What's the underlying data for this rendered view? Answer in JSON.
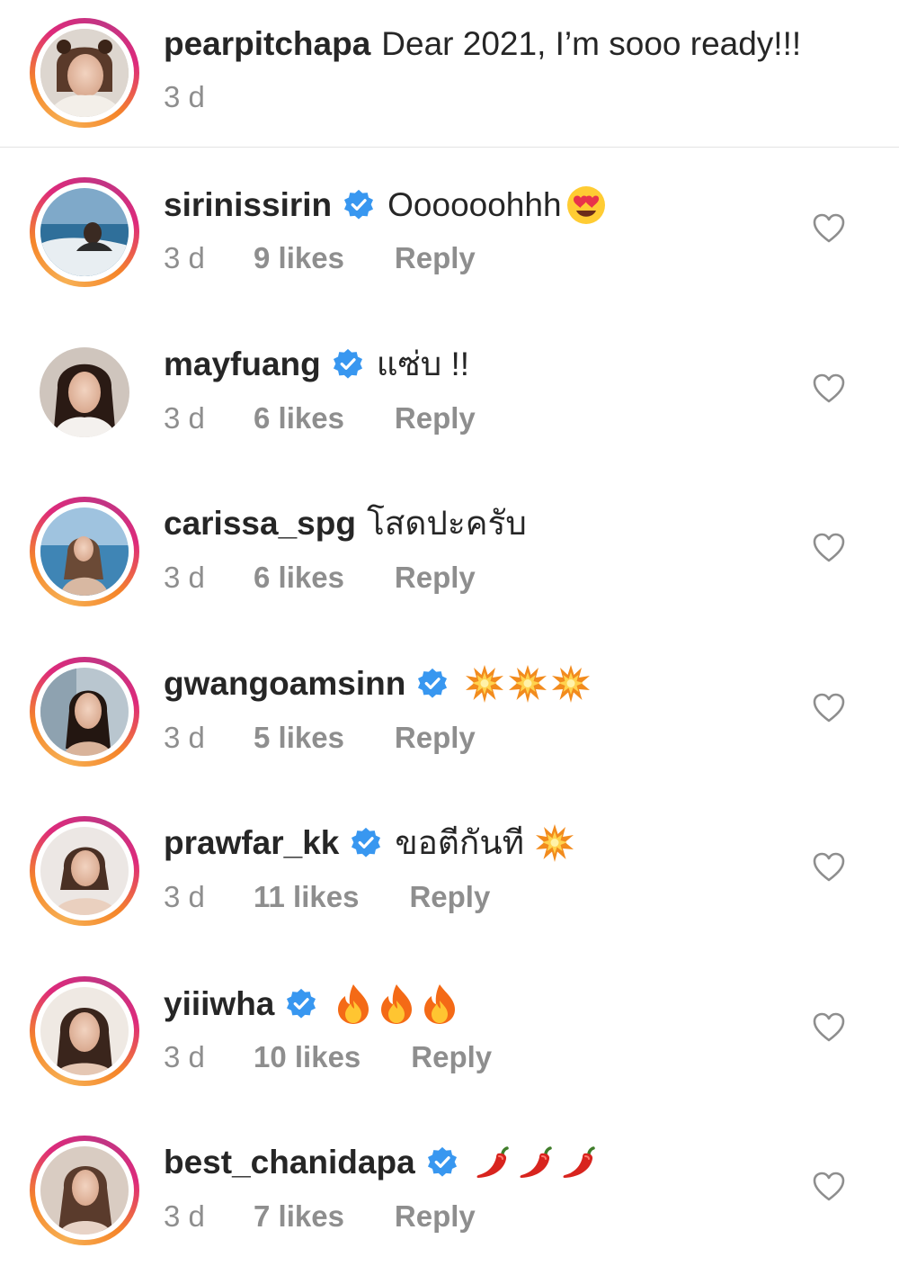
{
  "caption": {
    "username": "pearpitchapa",
    "text": "Dear 2021, I’m sooo ready!!!",
    "time": "3 d"
  },
  "comments": [
    {
      "username": "sirinissirin",
      "verified": true,
      "text": "Oooooohhh",
      "emoji": "heart-eyes-emoji",
      "time": "3 d",
      "likes": "9 likes",
      "reply": "Reply"
    },
    {
      "username": "mayfuang",
      "verified": true,
      "text": "แซ่บ !!",
      "emoji": "",
      "time": "3 d",
      "likes": "6 likes",
      "reply": "Reply"
    },
    {
      "username": "carissa_spg",
      "verified": false,
      "text": "โสดปะครับ",
      "emoji": "",
      "time": "3 d",
      "likes": "6 likes",
      "reply": "Reply"
    },
    {
      "username": "gwangoamsinn",
      "verified": true,
      "text": "",
      "emoji": "collision-emoji x3",
      "time": "3 d",
      "likes": "5 likes",
      "reply": "Reply"
    },
    {
      "username": "prawfar_kk",
      "verified": true,
      "text": "ขอตีกันที",
      "emoji": "collision-emoji",
      "time": "3 d",
      "likes": "11 likes",
      "reply": "Reply"
    },
    {
      "username": "yiiiwha",
      "verified": true,
      "text": "",
      "emoji": "fire-emoji x3",
      "time": "3 d",
      "likes": "10 likes",
      "reply": "Reply"
    },
    {
      "username": "best_chanidapa",
      "verified": true,
      "text": "",
      "emoji": "hot-pepper-emoji x3",
      "time": "3 d",
      "likes": "7 likes",
      "reply": "Reply"
    }
  ],
  "colors": {
    "text": "#262626",
    "meta": "#8e8e8e",
    "verified": "#3897f0",
    "ring_start": "#f58529",
    "ring_end": "#dd2a7b",
    "divider": "#e3e3e3"
  }
}
